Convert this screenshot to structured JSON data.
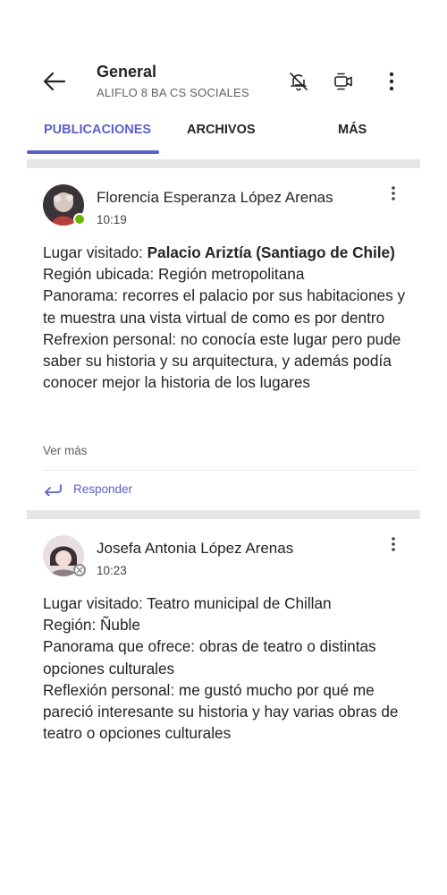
{
  "header": {
    "title": "General",
    "subtitle": "ALIFLO 8 BA CS SOCIALES",
    "icons": [
      "back-arrow-icon",
      "bell-muted-icon",
      "video-call-icon",
      "more-vertical-icon"
    ]
  },
  "tabs": [
    {
      "label": "PUBLICACIONES",
      "active": true
    },
    {
      "label": "ARCHIVOS",
      "active": false
    },
    {
      "label": "MÁS",
      "active": false
    }
  ],
  "posts": [
    {
      "author": "Florencia Esperanza López Arenas",
      "time": "10:19",
      "presence": "available",
      "line1_prefix": "Lugar visitado: ",
      "line1_bold": "Palacio Ariztía (Santiago de Chile)",
      "lines": [
        "Región ubicada: Región metropolitana",
        "Panorama: recorres el palacio por sus habitaciones y te muestra una vista virtual de como es por dentro",
        "Refrexion personal: no conocía este lugar pero pude saber su historia y su arquitectura, y además podía conocer mejor la historia de los lugares"
      ],
      "see_more": "Ver más",
      "reply": "Responder"
    },
    {
      "author": "Josefa Antonia López Arenas",
      "time": "10:23",
      "presence": "offline",
      "lines": [
        "Lugar visitado: Teatro municipal de Chillan",
        "Región: Ñuble",
        "Panorama que ofrece: obras de teatro o distintas opciones culturales",
        "Reflexión personal: me gustó mucho por qué me pareció interesante su historia y hay varias obras de teatro o opciones culturales"
      ]
    }
  ],
  "colors": {
    "accent": "#5b5fc7",
    "presence_available": "#6bb700",
    "presence_offline": "#8a8a8a",
    "band": "#e6e6e6"
  }
}
